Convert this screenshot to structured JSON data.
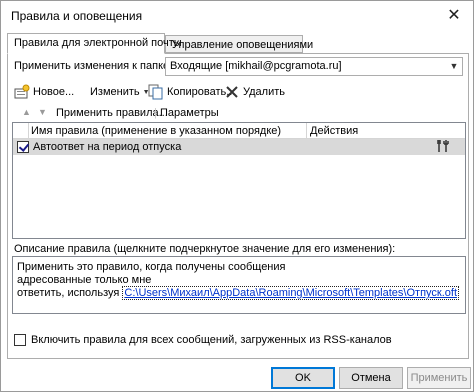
{
  "window": {
    "title": "Правила и оповещения",
    "close_glyph": "✕"
  },
  "tabs": [
    {
      "label": "Правила для электронной почты",
      "active": true
    },
    {
      "label": "Управление оповещениями",
      "active": false
    }
  ],
  "folder": {
    "label": "Применить изменения к папке:",
    "value": "Входящие [mikhail@pcgramota.ru]"
  },
  "toolbar": {
    "new": "Новое...",
    "change": "Изменить",
    "copy": "Копировать...",
    "delete": "Удалить",
    "move_up_icon": "▲",
    "move_down_icon": "▼",
    "apply_rules": "Применить правила...",
    "options": "Параметры"
  },
  "rules_table": {
    "col_name": "Имя правила (применение в указанном порядке)",
    "col_actions": "Действия",
    "rows": [
      {
        "name": "Автоответ на период отпуска",
        "checked": true
      }
    ]
  },
  "description": {
    "label": "Описание правила (щелкните подчеркнутое значение для его изменения):",
    "line1": "Применить это правило, когда получены сообщения",
    "line2": "адресованные только мне",
    "line3_prefix": "ответить, используя",
    "line3_link": "C:\\Users\\Михаил\\AppData\\Roaming\\Microsoft\\Templates\\Отпуск.oft"
  },
  "rss": {
    "label": "Включить правила для всех сообщений, загруженных из RSS-каналов",
    "checked": false
  },
  "buttons": {
    "ok": "OK",
    "cancel": "Отмена",
    "apply": "Применить"
  }
}
